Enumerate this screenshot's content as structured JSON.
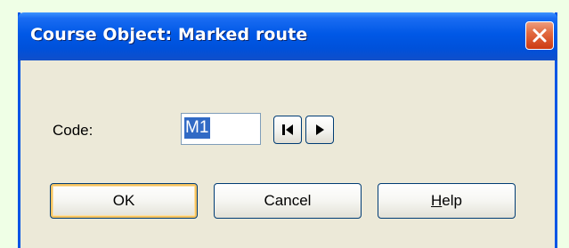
{
  "window": {
    "title": "Course Object: Marked route",
    "close_icon": "close-icon"
  },
  "form": {
    "code_label": "Code:",
    "code_value": "M1",
    "first_icon": "skip-to-first-icon",
    "next_icon": "play-next-icon"
  },
  "buttons": {
    "ok_label": "OK",
    "cancel_label": "Cancel",
    "help_mnemonic": "H",
    "help_rest": "elp"
  },
  "colors": {
    "titlebar": "#0058e6",
    "dialog_face": "#ece9d8",
    "selection": "#316ac5",
    "close_button": "#e26a40",
    "page_background": "#efffe6"
  }
}
